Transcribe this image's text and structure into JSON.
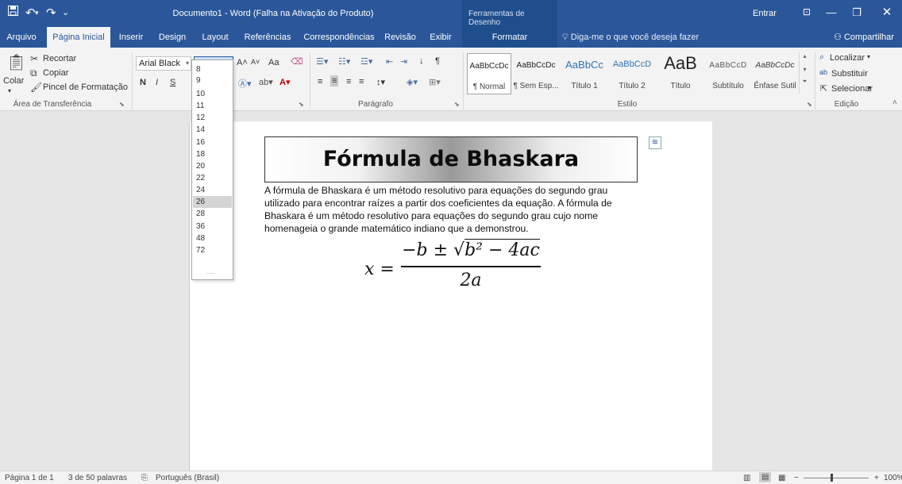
{
  "titlebar": {
    "title": "Documento1  -  Word (Falha na Ativação do Produto)",
    "drawing_tools": "Ferramentas de Desenho",
    "signin": "Entrar",
    "qat": {
      "save_icon": "save-icon",
      "undo": "↶",
      "redo": "↷",
      "customize": "⌄"
    }
  },
  "tabs": {
    "arquivo": "Arquivo",
    "inicio": "Página Inicial",
    "inserir": "Inserir",
    "design": "Design",
    "layout": "Layout",
    "referencias": "Referências",
    "correspondencias": "Correspondências",
    "revisao": "Revisão",
    "exibir": "Exibir",
    "formatar": "Formatar",
    "tellme": "Diga-me o que você deseja fazer",
    "share": "Compartilhar"
  },
  "clipboard": {
    "paste": "Colar",
    "cut": "Recortar",
    "copy": "Copiar",
    "painter": "Pincel de Formatação",
    "label": "Área de Transferência"
  },
  "font": {
    "name": "Arial Black",
    "size": "11",
    "bold": "N",
    "italic": "I",
    "underline": "S",
    "change_case": "Aa"
  },
  "paragraph": {
    "label": "Parágrafo"
  },
  "styles": {
    "label": "Estilo",
    "items": [
      {
        "preview": "AaBbCcDc",
        "name": "¶ Normal"
      },
      {
        "preview": "AaBbCcDc",
        "name": "¶ Sem Esp..."
      },
      {
        "preview": "AaBbCc",
        "name": "Título 1"
      },
      {
        "preview": "AaBbCcD",
        "name": "Título 2"
      },
      {
        "preview": "AaB",
        "name": "Título"
      },
      {
        "preview": "AaBbCcD",
        "name": "Subtítulo"
      },
      {
        "preview": "AaBbCcDc",
        "name": "Ênfase Sutil"
      }
    ]
  },
  "editing": {
    "label": "Edição",
    "find": "Localizar",
    "replace": "Substituir",
    "select": "Selecionar"
  },
  "size_list": [
    "8",
    "9",
    "10",
    "11",
    "12",
    "14",
    "16",
    "18",
    "20",
    "22",
    "24",
    "26",
    "28",
    "36",
    "48",
    "72"
  ],
  "size_list_highlight": "26",
  "document": {
    "heading": "Fórmula de Bhaskara",
    "paragraph": "A fórmula de Bhaskara é um método resolutivo para equações do segundo grau utilizado para encontrar raízes a partir dos coeficientes da equação. A fórmula de Bhaskara é um método resolutivo para equações do segundo grau cujo nome homenageia o grande matemático indiano que a demonstrou.",
    "formula": {
      "lhs": "x =",
      "num_pre": "−b ± √",
      "num_rad": "b² − 4ac",
      "den": "2a"
    }
  },
  "status": {
    "page": "Página 1 de 1",
    "words": "3 de 50 palavras",
    "language": "Português (Brasil)",
    "zoom": "100%"
  },
  "colors": {
    "accent": "#2b579a",
    "ribbon": "#f3f3f3",
    "canvas": "#e6e6e6"
  }
}
